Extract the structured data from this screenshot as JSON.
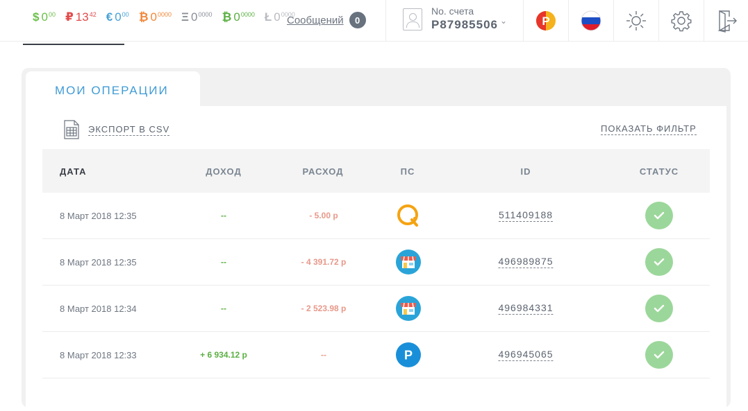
{
  "header": {
    "balances": [
      {
        "symbol": "$",
        "amount": "0",
        "fraction": "00",
        "color": "#6cc04a"
      },
      {
        "symbol": "₽",
        "amount": "13",
        "fraction": "42",
        "color": "#e24b4b"
      },
      {
        "symbol": "€",
        "amount": "0",
        "fraction": "00",
        "color": "#47a2d6"
      },
      {
        "symbol": "₿",
        "amount": "0",
        "fraction": "0000",
        "color": "#f2883a"
      },
      {
        "symbol": "Ξ",
        "amount": "0",
        "fraction": "0000",
        "color": "#8a8f98"
      },
      {
        "symbol": "₿",
        "amount": "0",
        "fraction": "0000",
        "color": "#5bb043"
      },
      {
        "symbol": "Ł",
        "amount": "0",
        "fraction": "0000",
        "color": "#8a8f98"
      }
    ],
    "messages_label": "Сообщений",
    "messages_count": "0",
    "account_label": "No. счета",
    "account_number": "P87985506",
    "icons": [
      "payeer-logo-icon",
      "russia-flag-icon",
      "brightness-icon",
      "gear-icon",
      "logout-icon"
    ]
  },
  "panel": {
    "tab_label": "МОИ ОПЕРАЦИИ",
    "export_label": "ЭКСПОРТ В CSV",
    "filter_label": "ПОКАЗАТЬ ФИЛЬТР"
  },
  "table": {
    "columns": [
      "ДАТА",
      "ДОХОД",
      "РАСХОД",
      "ПС",
      "ID",
      "СТАТУС"
    ],
    "rows": [
      {
        "date": "8 Март 2018 12:35",
        "income": "--",
        "expense": "- 5.00 р",
        "ps": "qiwi-icon",
        "id": "511409188",
        "status": "success"
      },
      {
        "date": "8 Март 2018 12:35",
        "income": "--",
        "expense": "- 4 391.72 р",
        "ps": "shop-icon",
        "id": "496989875",
        "status": "success"
      },
      {
        "date": "8 Март 2018 12:34",
        "income": "--",
        "expense": "- 2 523.98 р",
        "ps": "shop-icon",
        "id": "496984331",
        "status": "success"
      },
      {
        "date": "8 Март 2018 12:33",
        "income": "+ 6 934.12 р",
        "expense": "--",
        "ps": "payeer-icon",
        "id": "496945065",
        "status": "success"
      }
    ]
  },
  "colors": {
    "accent": "#3f9bd6",
    "income": "#5bb043",
    "expense": "#e8988a",
    "status_ok": "#9bd79a"
  }
}
